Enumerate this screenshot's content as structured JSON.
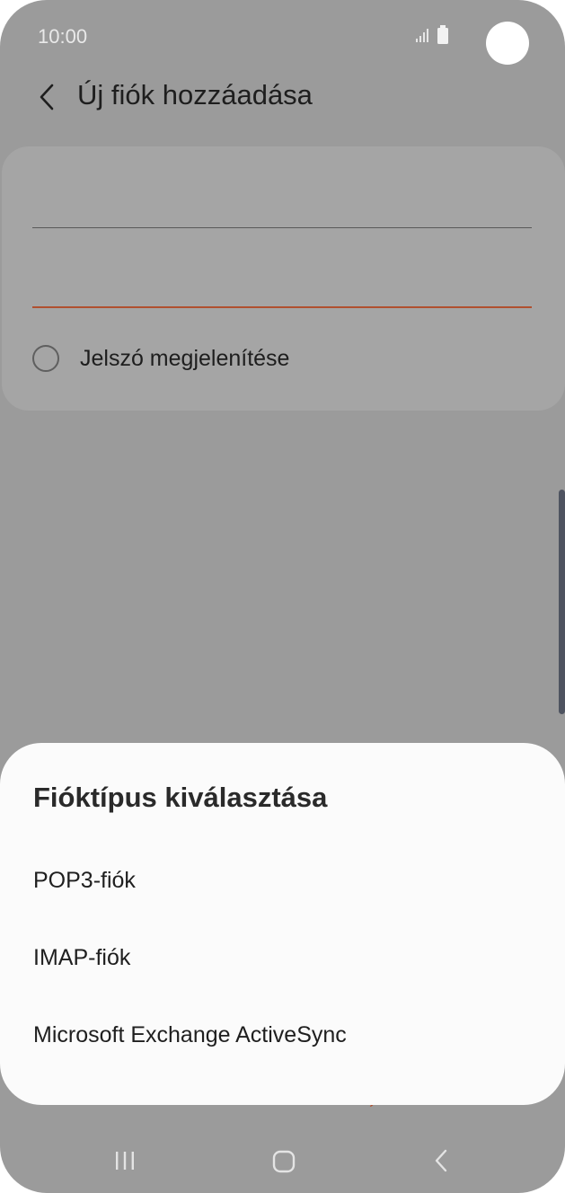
{
  "status_bar": {
    "time": "10:00",
    "icons": [
      "signal-icon",
      "battery-icon"
    ]
  },
  "header": {
    "back_icon": "chevron-left-icon",
    "title": "Új fiók hozzáadása"
  },
  "form": {
    "field_1_value": "",
    "field_2_value": "",
    "show_password_label": "Jelszó megjelenítése",
    "show_password_checked": false
  },
  "sheet": {
    "title": "Fióktípus kiválasztása",
    "items": [
      {
        "label": "POP3-fiók"
      },
      {
        "label": "IMAP-fiók"
      },
      {
        "label": "Microsoft Exchange ActiveSync"
      }
    ]
  },
  "nav_bar": {
    "icons": [
      "recent-apps-icon",
      "home-icon",
      "back-icon"
    ]
  },
  "colors": {
    "scrim": "#9b9b9b",
    "accent": "#b0502f",
    "sheet_bg": "#fbfbfb"
  }
}
